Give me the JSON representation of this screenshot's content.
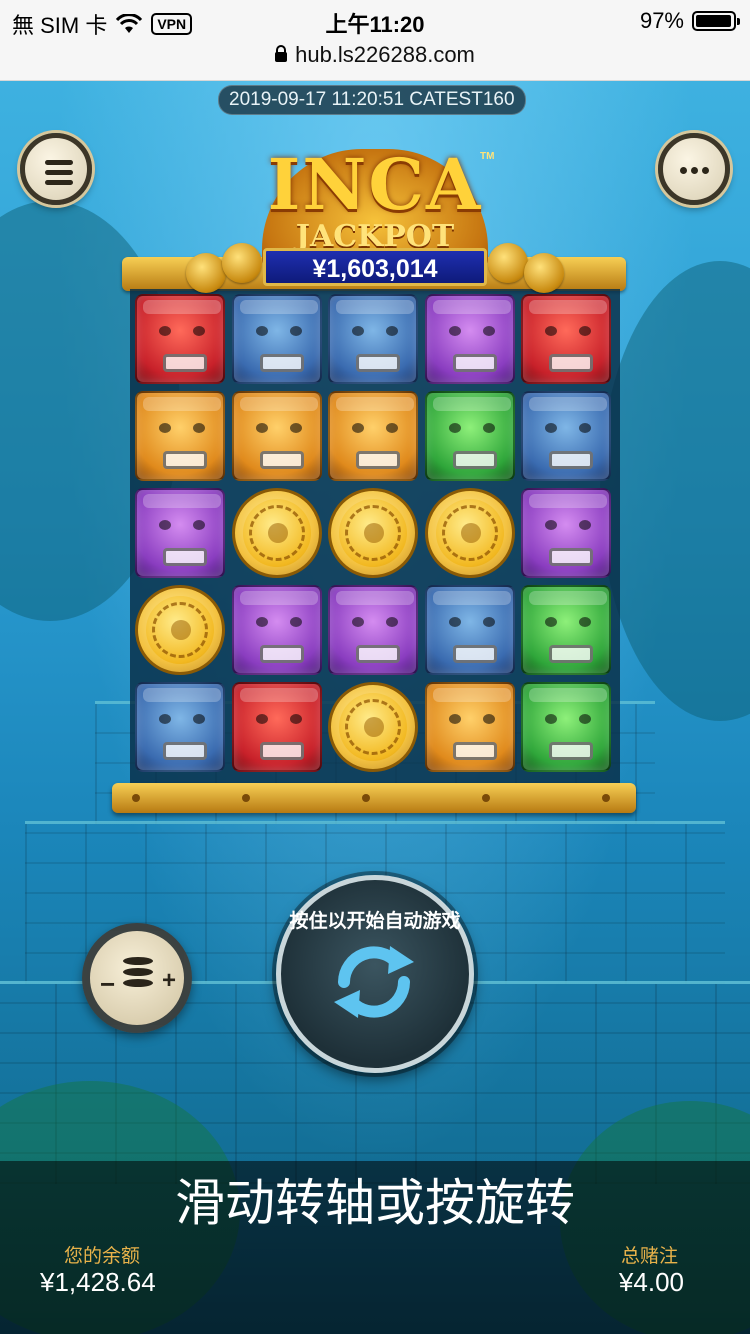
{
  "status_bar": {
    "carrier": "無 SIM 卡",
    "vpn": "VPN",
    "time": "上午11:20",
    "battery_percent": "97%",
    "battery_level": 0.97,
    "url": "hub.ls226288.com"
  },
  "game": {
    "server_info": "2019-09-17 11:20:51 CATEST160",
    "logo_title": "INCA",
    "logo_subtitle": "JACKPOT",
    "logo_tm": "TM",
    "jackpot_amount": "¥1,603,014",
    "reels": [
      [
        "red-mask",
        "blue-mask",
        "blue-mask",
        "purple-mask",
        "red-mask"
      ],
      [
        "orange-mask",
        "orange-mask",
        "orange-mask",
        "green-mask",
        "blue-mask"
      ],
      [
        "purple-mask",
        "gold-coin",
        "gold-coin",
        "gold-coin",
        "purple-mask"
      ],
      [
        "gold-coin",
        "purple-mask",
        "purple-mask",
        "blue-mask",
        "green-mask"
      ],
      [
        "blue-mask",
        "red-mask",
        "gold-coin",
        "orange-mask",
        "green-mask"
      ]
    ],
    "spin_hint": "按住以开始自动游戏",
    "swipe_hint": "滑动转轴或按旋转",
    "balance_label": "您的余额",
    "balance_value": "¥1,428.64",
    "bet_label": "总赌注",
    "bet_value": "¥4.00",
    "bet_minus": "−",
    "bet_plus": "+"
  },
  "colors": {
    "accent_gold": "#e8b24a",
    "jackpot_blue": "#1f2fb0"
  }
}
